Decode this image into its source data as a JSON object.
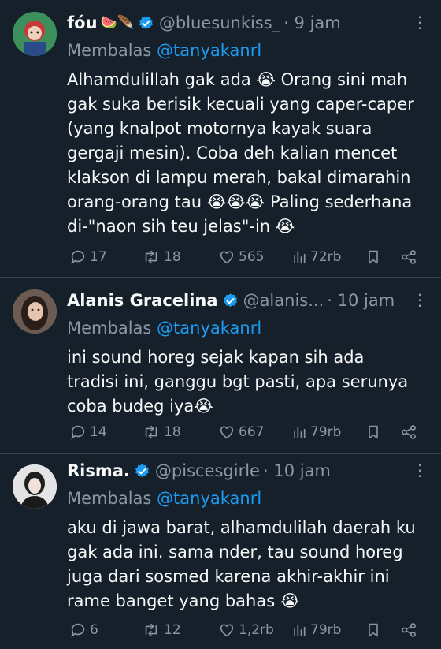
{
  "tweets": [
    {
      "name": "fóu",
      "name_emoji": "🍉🪶",
      "handle": "@bluesunkiss_",
      "time": "· 9 jam",
      "reply_prefix": "Membalas",
      "reply_to": "@tanyakanrl",
      "text": "Alhamdulillah gak ada 😭 Orang sini mah\ngak suka berisik kecuali yang caper-caper\n(yang knalpot motornya kayak suara\ngergaji mesin). Coba deh kalian mencet\nklakson di lampu merah, bakal dimarahin\norang-orang tau 😭😭😭 Paling sederhana\ndi-\"naon sih teu jelas\"-in 😭",
      "replies": "17",
      "reposts": "18",
      "likes": "565",
      "views": "72rb"
    },
    {
      "name": "Alanis Gracelina",
      "handle": "@alanis...",
      "time": "· 10 jam",
      "reply_prefix": "Membalas",
      "reply_to": "@tanyakanrl",
      "text": "ini sound horeg sejak kapan sih ada\ntradisi ini, ganggu bgt pasti, apa serunya\ncoba budeg iya😭",
      "replies": "14",
      "reposts": "18",
      "likes": "667",
      "views": "79rb"
    },
    {
      "name": "Risma.",
      "handle": "@piscesgirle",
      "time": "· 10 jam",
      "reply_prefix": "Membalas",
      "reply_to": "@tanyakanrl",
      "text": "aku di jawa barat, alhamdulilah daerah ku\ngak ada ini. sama nder, tau sound horeg\njuga dari sosmed karena akhir-akhir ini\nrame banget yang bahas 😭",
      "replies": "6",
      "reposts": "12",
      "likes": "1,2rb",
      "views": "79rb"
    }
  ],
  "more_icon": "more-horizontal-icon",
  "colors": {
    "background": "#15202b",
    "text": "#f7f9f9",
    "secondary": "#8b98a5",
    "accent": "#1d9bf0",
    "divider": "#38444d"
  }
}
